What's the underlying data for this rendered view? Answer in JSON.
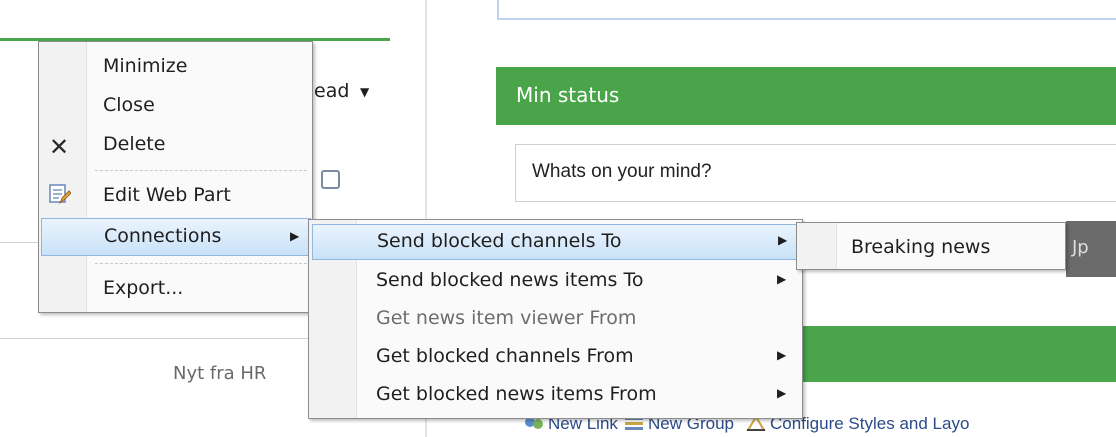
{
  "background": {
    "left_header_fragment": "ead",
    "left_header_arrow": "▼",
    "left_footer_text": "Nyt fra HR",
    "status_title": "Min status",
    "status_placeholder": "Whats on your mind?",
    "right_tab_fragment": "Jp",
    "toolbar": {
      "new_link": "New Link",
      "new_group": "New Group",
      "configure": "Configure Styles and Layo"
    }
  },
  "web_part_menu": {
    "items": [
      {
        "label": "Minimize",
        "icon": null
      },
      {
        "label": "Close",
        "icon": null
      },
      {
        "label": "Delete",
        "icon": "delete-x-icon"
      },
      {
        "label": "Edit Web Part",
        "icon": "edit-web-part-icon"
      },
      {
        "label": "Connections",
        "icon": null,
        "submenu_arrow": "▶",
        "highlighted": true
      },
      {
        "label": "Export...",
        "icon": null
      }
    ]
  },
  "connections_menu": {
    "items": [
      {
        "label": "Send blocked channels To",
        "submenu_arrow": "▶",
        "highlighted": true,
        "enabled": true
      },
      {
        "label": "Send blocked news items To",
        "submenu_arrow": "▶",
        "enabled": true
      },
      {
        "label": "Get news item viewer From",
        "enabled": false
      },
      {
        "label": "Get blocked channels From",
        "submenu_arrow": "▶",
        "enabled": true
      },
      {
        "label": "Get blocked news items From",
        "submenu_arrow": "▶",
        "enabled": true
      }
    ]
  },
  "target_menu": {
    "items": [
      {
        "label": "Breaking news"
      }
    ]
  },
  "colors": {
    "accent_green": "#4aa54a",
    "highlight_blue": "#c9e2f8"
  }
}
